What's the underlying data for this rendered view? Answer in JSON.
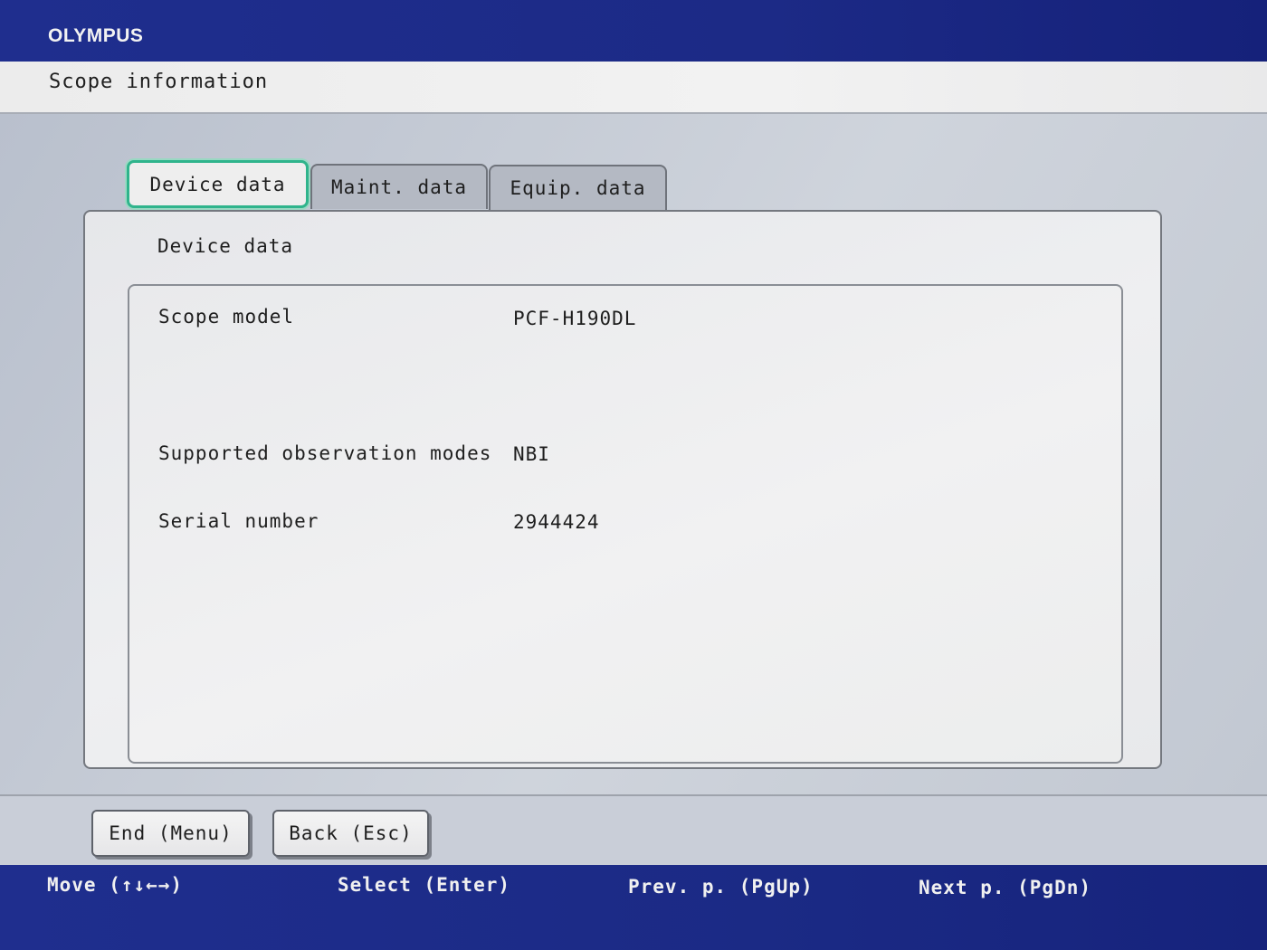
{
  "header": {
    "brand": "OLYMPUS"
  },
  "title": "Scope information",
  "tabs": [
    {
      "label": "Device data",
      "active": true
    },
    {
      "label": "Maint. data",
      "active": false
    },
    {
      "label": "Equip. data",
      "active": false
    }
  ],
  "section": {
    "title": "Device data",
    "rows": [
      {
        "label": "Scope model",
        "value": "PCF-H190DL"
      },
      {
        "label": "Supported observation modes",
        "value": "NBI"
      },
      {
        "label": "Serial number",
        "value": "2944424"
      }
    ]
  },
  "buttons": {
    "end": "End (Menu)",
    "back": "Back (Esc)"
  },
  "key_hints": {
    "move": "Move (↑↓←→)",
    "select": "Select (Enter)",
    "prev": "Prev. p. (PgUp)",
    "next": "Next p. (PgDn)"
  },
  "colors": {
    "header_blue": "#1f2e8e",
    "active_tab_border": "#2fb48c"
  }
}
